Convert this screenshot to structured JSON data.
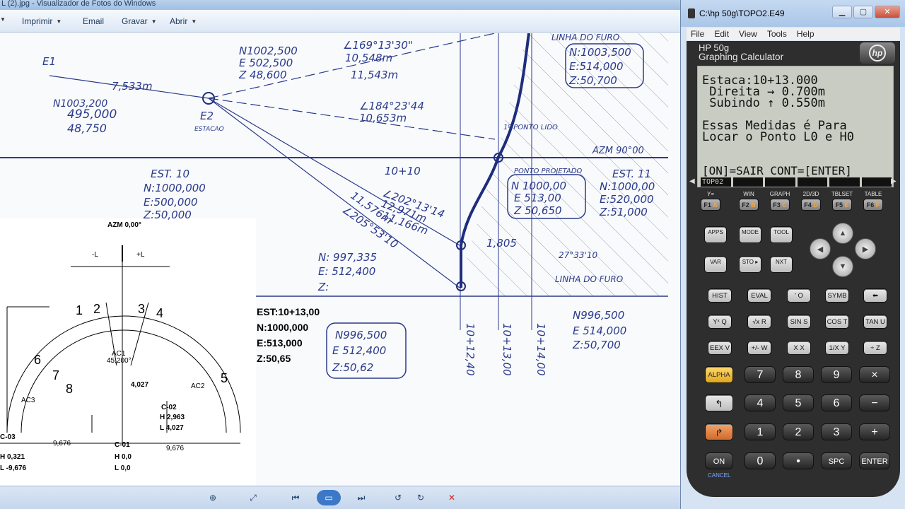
{
  "viewer": {
    "title": "L (2).jpg - Visualizador de Fotos do Windows",
    "toolbar": [
      "Imprimir",
      "Email",
      "Gravar",
      "Abrir"
    ]
  },
  "photo": {
    "sketch_labels": [
      "EST:10+13,00",
      "N:1000,000",
      "E:513,000",
      "Z:50,65"
    ]
  },
  "emulator": {
    "title": "C:\\hp 50g\\TOPO2.E49",
    "menu": [
      "File",
      "Edit",
      "View",
      "Tools",
      "Help"
    ],
    "brand_line1": "HP 50g",
    "brand_line2": "Graphing Calculator",
    "logo": "hp",
    "lcd": [
      "Estaca:10+13.000",
      " Direita → 0.700m",
      " Subindo ↑ 0.550m",
      "",
      "Essas Medidas é Para",
      "Locar o Ponto L0 e H0",
      "",
      "[ON]=SAIR CONT=[ENTER]"
    ],
    "lcd_menu": [
      "TOP02",
      "",
      "",
      "",
      "",
      ""
    ],
    "fkeys": [
      {
        "top": "Y=",
        "label": "F1",
        "sub": "A"
      },
      {
        "top": "WIN",
        "label": "F2",
        "sub": "B"
      },
      {
        "top": "GRAPH",
        "label": "F3",
        "sub": "C"
      },
      {
        "top": "2D/3D",
        "label": "F4",
        "sub": "D"
      },
      {
        "top": "TBLSET",
        "label": "F5",
        "sub": "E"
      },
      {
        "top": "TABLE",
        "label": "F6",
        "sub": "F"
      }
    ]
  }
}
